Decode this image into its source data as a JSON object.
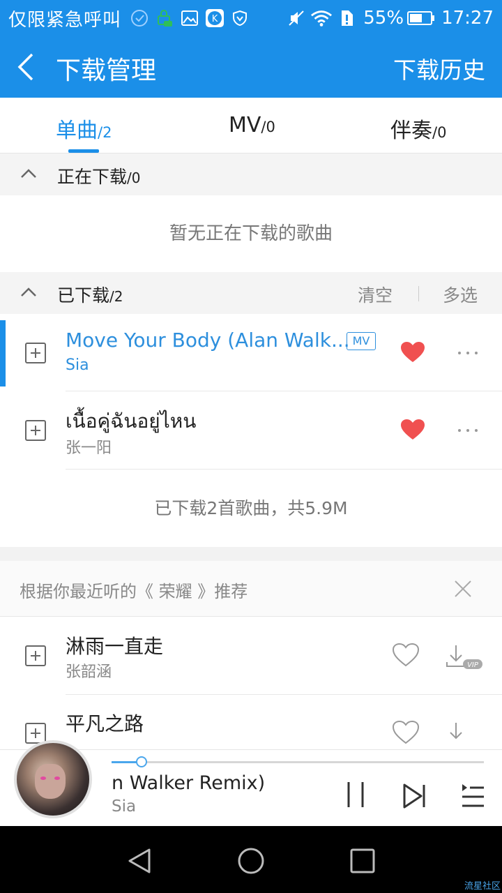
{
  "status_bar": {
    "carrier": "仅限紧急呼叫",
    "battery": "55%",
    "time": "17:27"
  },
  "app_bar": {
    "title": "下载管理",
    "history": "下载历史"
  },
  "tabs": [
    {
      "label": "单曲",
      "count": "/2",
      "active": true
    },
    {
      "label": "MV",
      "count": "/0",
      "active": false
    },
    {
      "label": "伴奏",
      "count": "/0",
      "active": false
    }
  ],
  "downloading": {
    "label": "正在下载",
    "count": "/0",
    "empty_message": "暂无正在下载的歌曲"
  },
  "downloaded": {
    "label": "已下载",
    "count": "/2",
    "clear": "清空",
    "multi_select": "多选",
    "songs": [
      {
        "title": "Move Your Body (Alan Walk...",
        "artist": "Sia",
        "badge": "MV",
        "playing": true
      },
      {
        "title": "เนื้อคู่ฉันอยู่ไหน",
        "artist": "张一阳",
        "playing": false
      }
    ],
    "summary": "已下载2首歌曲，共5.9M"
  },
  "recommend": {
    "title": "根据你最近听的《 荣耀 》推荐",
    "songs": [
      {
        "title": "淋雨一直走",
        "artist": "张韶涵",
        "download_badge": "VIP"
      },
      {
        "title": "平凡之路",
        "artist": ""
      }
    ]
  },
  "player": {
    "title": "n Walker Remix)",
    "artist": "Sia",
    "progress": 0.08
  },
  "colors": {
    "accent": "#1b8fe8",
    "heart": "#f05050"
  },
  "watermark": "流星社区"
}
